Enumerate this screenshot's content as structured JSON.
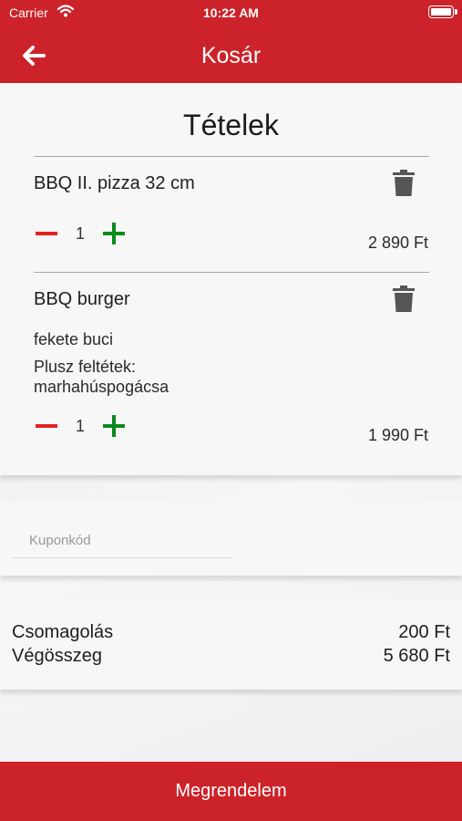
{
  "status_bar": {
    "carrier": "Carrier",
    "time": "10:22 AM"
  },
  "header": {
    "title": "Kosár"
  },
  "items_section": {
    "title": "Tételek",
    "items": [
      {
        "name": "BBQ II. pizza 32 cm",
        "options": [],
        "quantity": "1",
        "price": "2 890 Ft"
      },
      {
        "name": "BBQ burger",
        "options": [
          "fekete buci",
          "Plusz feltétek:",
          "marhahúspogácsa"
        ],
        "quantity": "1",
        "price": "1 990 Ft"
      }
    ]
  },
  "coupon": {
    "placeholder": "Kuponkód",
    "value": ""
  },
  "totals": {
    "packaging_label": "Csomagolás",
    "packaging_value": "200 Ft",
    "total_label": "Végösszeg",
    "total_value": "5 680 Ft"
  },
  "order_button": {
    "label": "Megrendelem"
  },
  "colors": {
    "brand_red": "#cc2229",
    "minus_red": "#e52222",
    "plus_green": "#0b8a1e"
  },
  "icons": [
    "back-arrow-icon",
    "wifi-icon",
    "battery-icon",
    "trash-icon",
    "minus-icon",
    "plus-icon"
  ]
}
